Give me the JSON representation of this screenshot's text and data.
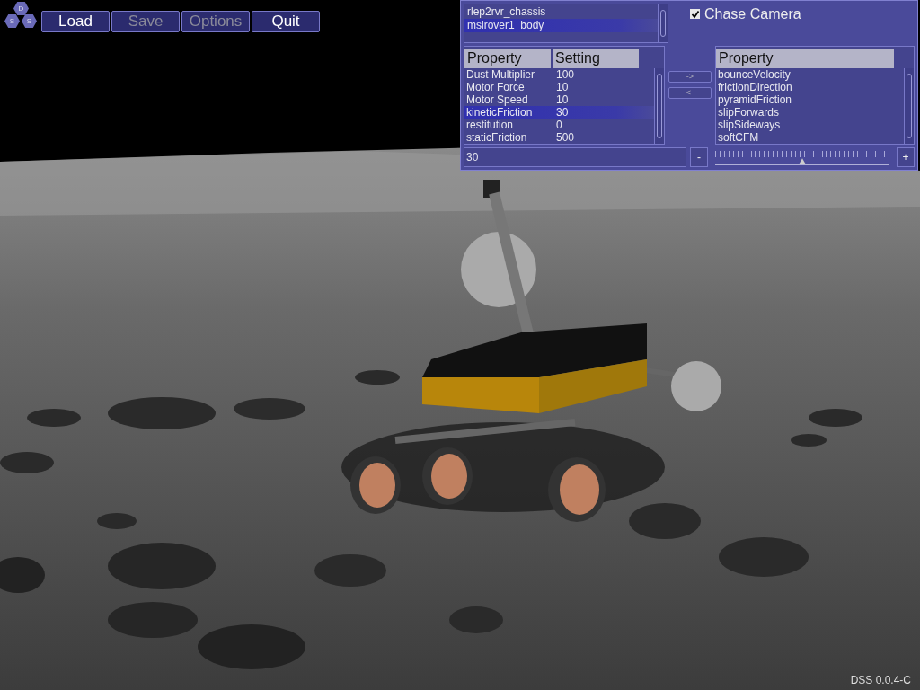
{
  "logo": {
    "letters": [
      "D",
      "S",
      "S"
    ]
  },
  "menu": [
    {
      "label": "Load",
      "disabled": false
    },
    {
      "label": "Save",
      "disabled": true
    },
    {
      "label": "Options",
      "disabled": true
    },
    {
      "label": "Quit",
      "disabled": false
    }
  ],
  "panel": {
    "bodies": [
      {
        "label": "rlep2rvr_chassis",
        "selected": false
      },
      {
        "label": "mslrover1_body",
        "selected": true
      }
    ],
    "properties": {
      "columns": [
        "Property",
        "Setting"
      ],
      "rows": [
        {
          "property": "Dust Multiplier",
          "setting": "100",
          "selected": false
        },
        {
          "property": "Motor Force",
          "setting": "10",
          "selected": false
        },
        {
          "property": "Motor Speed",
          "setting": "10",
          "selected": false
        },
        {
          "property": "kineticFriction",
          "setting": "30",
          "selected": true
        },
        {
          "property": "restitution",
          "setting": "0",
          "selected": false
        },
        {
          "property": "staticFriction",
          "setting": "500",
          "selected": false
        }
      ]
    },
    "move_right": "->",
    "move_left": "<-",
    "chase_camera": {
      "label": "Chase Camera",
      "checked": true
    },
    "available": {
      "column": "Property",
      "rows": [
        {
          "label": "bounceVelocity",
          "selected": false
        },
        {
          "label": "frictionDirection",
          "selected": false
        },
        {
          "label": "pyramidFriction",
          "selected": false
        },
        {
          "label": "slipForwards",
          "selected": false
        },
        {
          "label": "slipSideways",
          "selected": false
        },
        {
          "label": "softCFM",
          "selected": false
        }
      ]
    },
    "value_field": {
      "value": "30"
    },
    "minus": "-",
    "plus": "+",
    "slider": {
      "level": 0.5
    }
  },
  "version": "DSS 0.0.4-C"
}
